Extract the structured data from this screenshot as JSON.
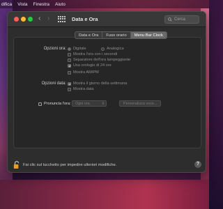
{
  "menubar": [
    "difica",
    "Vista",
    "Finestra",
    "Aiuto"
  ],
  "window": {
    "title": "Data e Ora",
    "search_placeholder": "Cerca",
    "nav_back": "‹",
    "nav_forward": "›"
  },
  "tabs": [
    {
      "label": "Data e Ora",
      "active": false
    },
    {
      "label": "Fuso orario",
      "active": false
    },
    {
      "label": "Menu Bar Clock",
      "active": true
    }
  ],
  "time_options": {
    "label": "Opzioni ora:",
    "radio_digital": "Digitale",
    "radio_analog": "Analogica",
    "show_seconds": "Mostra l'ora con i secondi",
    "flash_separators": "Separatore dell'ora lampeggiante",
    "use_24h": "Usa orologio di 24 ore",
    "show_ampm": "Mostra AM/PM"
  },
  "date_options": {
    "label": "Opzioni data:",
    "show_weekday": "Mostra il giorno della settimana",
    "show_date": "Mostra data"
  },
  "announce": {
    "label": "Pronuncia l'ora:",
    "select_value": "Ogni ora",
    "customize_button": "Personalizza voce..."
  },
  "footer": {
    "lock_text": "Fai clic sul lucchetto per impedire ulteriori modifiche.",
    "help": "?"
  }
}
